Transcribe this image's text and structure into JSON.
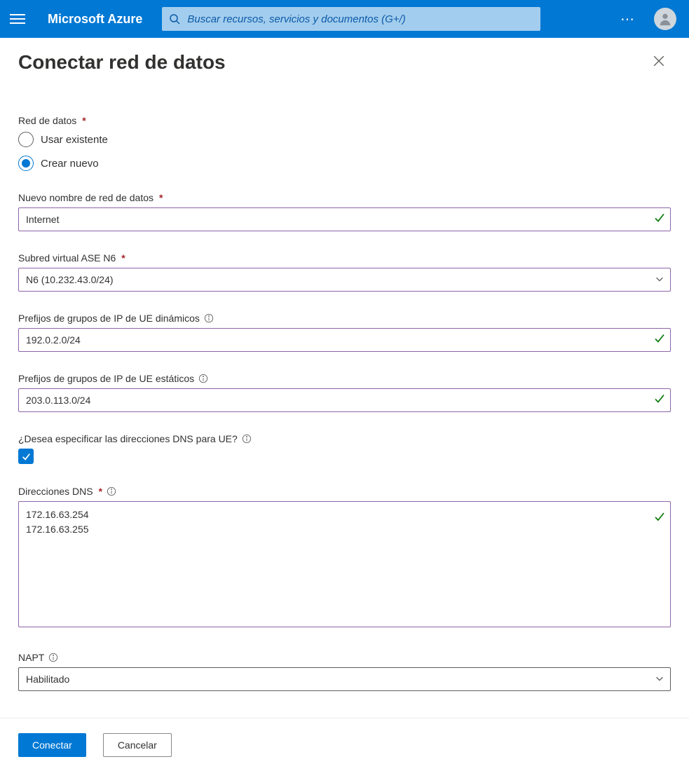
{
  "header": {
    "brand": "Microsoft Azure",
    "search_placeholder": "Buscar recursos, servicios y documentos (G+/)"
  },
  "page": {
    "title": "Conectar red de datos"
  },
  "form": {
    "data_network_label": "Red de datos",
    "radio_existing": "Usar existente",
    "radio_new": "Crear nuevo",
    "radio_selected": "new",
    "new_name_label": "Nuevo nombre de red de datos",
    "new_name_value": "Internet",
    "subnet_label": "Subred virtual ASE N6",
    "subnet_value": "N6 (10.232.43.0/24)",
    "dyn_prefix_label": "Prefijos de grupos de IP de UE dinámicos",
    "dyn_prefix_value": "192.0.2.0/24",
    "stat_prefix_label": "Prefijos de grupos de IP de UE estáticos",
    "stat_prefix_value": "203.0.113.0/24",
    "dns_q_label": "¿Desea especificar las direcciones DNS para UE?",
    "dns_q_checked": true,
    "dns_label": "Direcciones DNS",
    "dns_value": "172.16.63.254\n172.16.63.255",
    "napt_label": "NAPT",
    "napt_value": "Habilitado"
  },
  "footer": {
    "submit": "Conectar",
    "cancel": "Cancelar"
  }
}
